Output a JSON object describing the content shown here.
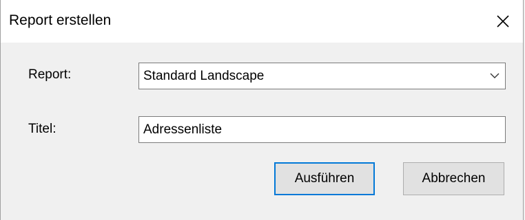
{
  "dialog": {
    "title": "Report erstellen",
    "close_icon": "close-icon"
  },
  "form": {
    "report_label": "Report:",
    "report_selected": "Standard Landscape",
    "report_dropdown_icon": "chevron-down-icon",
    "titel_label": "Titel:",
    "titel_value": "Adressenliste"
  },
  "buttons": {
    "ok_label": "Ausführen",
    "cancel_label": "Abbrechen"
  },
  "colors": {
    "focus_border": "#0078d7",
    "button_face": "#e1e1e1",
    "dialog_background": "#f0f0f0"
  }
}
